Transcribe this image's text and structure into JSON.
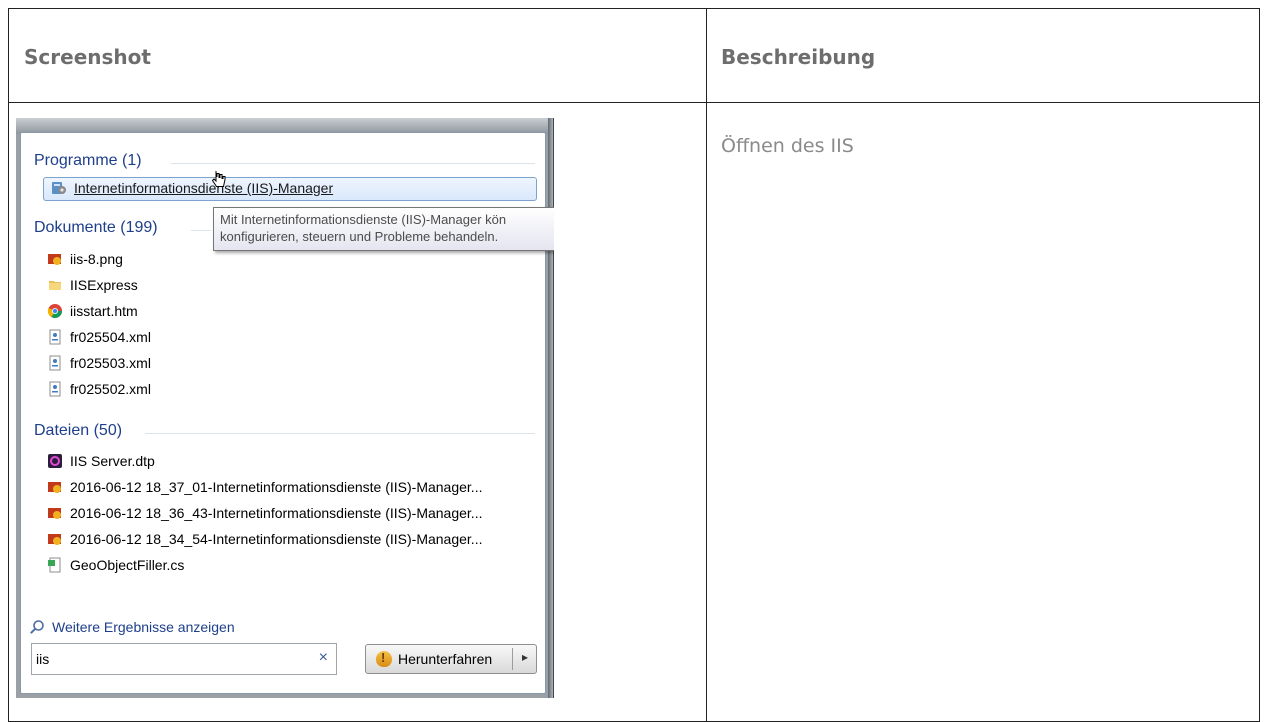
{
  "table": {
    "col_screenshot": "Screenshot",
    "col_description": "Beschreibung",
    "description": "Öffnen des IIS"
  },
  "start_menu": {
    "programs_header": "Programme (1)",
    "program_item": "Internetinformationsdienste (IIS)-Manager",
    "tooltip_line1": "Mit Internetinformationsdienste (IIS)-Manager kön",
    "tooltip_line2": "konfigurieren, steuern und Probleme behandeln.",
    "documents_header": "Dokumente (199)",
    "documents": [
      {
        "label": "iis-8.png",
        "icon": "image-file-icon"
      },
      {
        "label": "IISExpress",
        "icon": "folder-icon"
      },
      {
        "label": "iisstart.htm",
        "icon": "chrome-icon"
      },
      {
        "label": "fr025504.xml",
        "icon": "xml-file-icon"
      },
      {
        "label": "fr025503.xml",
        "icon": "xml-file-icon"
      },
      {
        "label": "fr025502.xml",
        "icon": "xml-file-icon"
      }
    ],
    "files_header": "Dateien (50)",
    "files": [
      {
        "label": "IIS Server.dtp",
        "icon": "dtp-file-icon"
      },
      {
        "label": "2016-06-12 18_37_01-Internetinformationsdienste (IIS)-Manager...",
        "icon": "image-file-icon"
      },
      {
        "label": "2016-06-12 18_36_43-Internetinformationsdienste (IIS)-Manager...",
        "icon": "image-file-icon"
      },
      {
        "label": "2016-06-12 18_34_54-Internetinformationsdienste (IIS)-Manager...",
        "icon": "image-file-icon"
      },
      {
        "label": "GeoObjectFiller.cs",
        "icon": "cs-file-icon"
      }
    ],
    "more_results": "Weitere Ergebnisse anzeigen",
    "search_value": "iis",
    "clear_glyph": "×",
    "shutdown_label": "Herunterfahren",
    "shutdown_arrow": "▸"
  }
}
